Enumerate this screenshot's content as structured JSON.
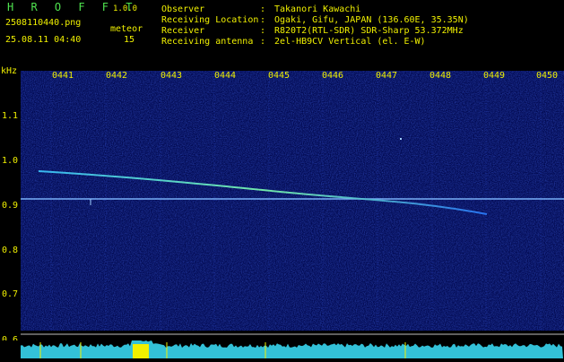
{
  "app": {
    "logo": "H R O F F T",
    "version": "1.0.0",
    "filename": "2508110440.png",
    "datetime": "25.08.11 04:40",
    "meteor_label": "meteor",
    "meteor_count": "15"
  },
  "info": [
    {
      "key": "Observer",
      "sep": ":",
      "value": "Takanori Kawachi"
    },
    {
      "key": "Receiving Location",
      "sep": ":",
      "value": "Ogaki, Gifu, JAPAN (136.60E, 35.35N)"
    },
    {
      "key": "Receiver",
      "sep": ":",
      "value": "R820T2(RTL-SDR) SDR-Sharp 53.372MHz"
    },
    {
      "key": "Receiving antenna",
      "sep": ":",
      "value": "2el-HB9CV Vertical (el. E-W)"
    }
  ],
  "axis": {
    "unit": "kHz",
    "y_ticks": [
      "1.1",
      "1.0",
      "0.9",
      "0.8",
      "0.7",
      "0.6"
    ],
    "time_ticks": [
      "0441",
      "0442",
      "0443",
      "0444",
      "0445",
      "0446",
      "0447",
      "0448",
      "0449",
      "0450"
    ]
  },
  "colors": {
    "background": "#000000",
    "spectrogram_bg": "#020a52",
    "label": "#f0f000",
    "carrier": "#7fb8ff",
    "meteor_trail": "#46e0ff",
    "signal_level": "#38d6f0"
  }
}
